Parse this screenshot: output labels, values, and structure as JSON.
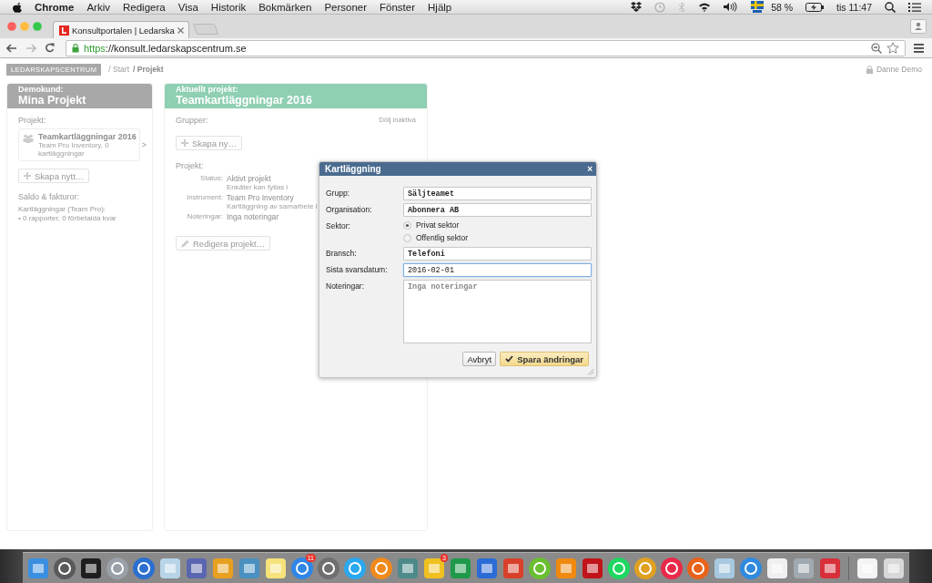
{
  "menubar": {
    "app": "Chrome",
    "menus": [
      "Arkiv",
      "Redigera",
      "Visa",
      "Historik",
      "Bokmärken",
      "Personer",
      "Fönster",
      "Hjälp"
    ],
    "battery": "58 %",
    "clock": "tis 11:47"
  },
  "browser": {
    "tabs": [
      {
        "title": "Konsultportalen | Ledarska",
        "selected": true
      }
    ],
    "url": {
      "scheme": "https",
      "rest": "://konsult.ledarskapscentrum.se"
    }
  },
  "page": {
    "logo": "LEDARSKAPSCENTRUM",
    "crumbs": [
      "/ Start",
      "/ Projekt"
    ],
    "user": "Danne Demo",
    "left_card": {
      "subtitle": "Demokund:",
      "title": "Mina Projekt",
      "section": "Projekt:",
      "project": {
        "title": "Teamkartläggningar 2016",
        "subtitle": "Team Pro Inventory, 0 kartläggningar",
        "chevron": ">"
      },
      "button": "Skapa nytt…",
      "section2": "Saldo & fakturor:",
      "balance_title": "Kartläggningar (Team Pro):",
      "balance_line": "• 0 rapporter, 0 förbetalda kvar"
    },
    "project_card": {
      "subtitle": "Aktuellt projekt:",
      "title": "Teamkartläggningar 2016",
      "groups_label": "Grupper:",
      "hide_link": "Dölj inaktiva",
      "button": "Skapa ny…",
      "project_label": "Projekt:",
      "details": [
        {
          "label": "Status:",
          "value": "Aktivt projekt",
          "note": "Enkäter kan fyllas i"
        },
        {
          "label": "Instrument:",
          "value": "Team Pro Inventory",
          "note": "Kartläggning av samarbete i"
        },
        {
          "label": "Noteringar:",
          "value": "Inga noteringar"
        }
      ],
      "edit_button": "Redigera projekt…"
    }
  },
  "dialog": {
    "title": "Kartläggning",
    "close": "×",
    "fields": [
      {
        "kind": "text",
        "label": "Grupp:",
        "value": "Säljteamet",
        "focused": false
      },
      {
        "kind": "text",
        "label": "Organisation:",
        "value": "Abonnera AB",
        "focused": false
      },
      {
        "kind": "radio",
        "label": "Sektor:",
        "options": [
          {
            "label": "Privat sektor",
            "selected": true
          },
          {
            "label": "Offentlig sektor",
            "selected": false
          }
        ]
      },
      {
        "kind": "text",
        "label": "Bransch:",
        "value": "Telefoni",
        "focused": false
      },
      {
        "kind": "text",
        "label": "Sista svarsdatum:",
        "value": "2016-02-01",
        "focused": true
      },
      {
        "kind": "textarea",
        "label": "Noteringar:",
        "placeholder": "Inga noteringar"
      }
    ],
    "buttons": [
      {
        "kind": "default",
        "label": "Avbryt"
      },
      {
        "kind": "primary",
        "label": "Spara ändringar"
      }
    ]
  },
  "dock": [
    {
      "kind": "square",
      "color": "#3b8fe0"
    },
    {
      "kind": "circle",
      "color": "#5a5a5a"
    },
    {
      "kind": "square",
      "color": "#1e1e1e"
    },
    {
      "kind": "circle",
      "color": "#9aa0a8"
    },
    {
      "kind": "circle",
      "color": "#2b6fd0"
    },
    {
      "kind": "square",
      "color": "#b8d4e8"
    },
    {
      "kind": "square",
      "color": "#5b66b0"
    },
    {
      "kind": "square",
      "color": "#e8a020"
    },
    {
      "kind": "square",
      "color": "#4a90c0"
    },
    {
      "kind": "square",
      "color": "#f6e27a"
    },
    {
      "kind": "circle",
      "color": "#2f86e6",
      "badge": "11"
    },
    {
      "kind": "circle",
      "color": "#6f6f6f"
    },
    {
      "kind": "circle",
      "color": "#2aa8f0"
    },
    {
      "kind": "circle",
      "color": "#f08a1c"
    },
    {
      "kind": "square",
      "color": "#4e8a8a"
    },
    {
      "kind": "square",
      "color": "#f0c020",
      "badge": "3"
    },
    {
      "kind": "square",
      "color": "#1f9a4a"
    },
    {
      "kind": "square",
      "color": "#2b6bd6"
    },
    {
      "kind": "square",
      "color": "#d8402a"
    },
    {
      "kind": "circle",
      "color": "#6abf30"
    },
    {
      "kind": "square",
      "color": "#f08a10"
    },
    {
      "kind": "square",
      "color": "#c0141a"
    },
    {
      "kind": "circle",
      "color": "#1ed760"
    },
    {
      "kind": "circle",
      "color": "#e0a020"
    },
    {
      "kind": "circle",
      "color": "#e82a48"
    },
    {
      "kind": "circle",
      "color": "#e8621a"
    },
    {
      "kind": "square",
      "color": "#a8c8e0"
    },
    {
      "kind": "circle",
      "color": "#2f8ae0"
    },
    {
      "kind": "square",
      "color": "#f0f0f0"
    },
    {
      "kind": "square",
      "color": "#a0a8b0"
    },
    {
      "kind": "square",
      "color": "#d8303a"
    },
    {
      "kind": "square",
      "color": "#f4f4f4"
    },
    {
      "kind": "square",
      "color": "#d8d8d8"
    }
  ]
}
